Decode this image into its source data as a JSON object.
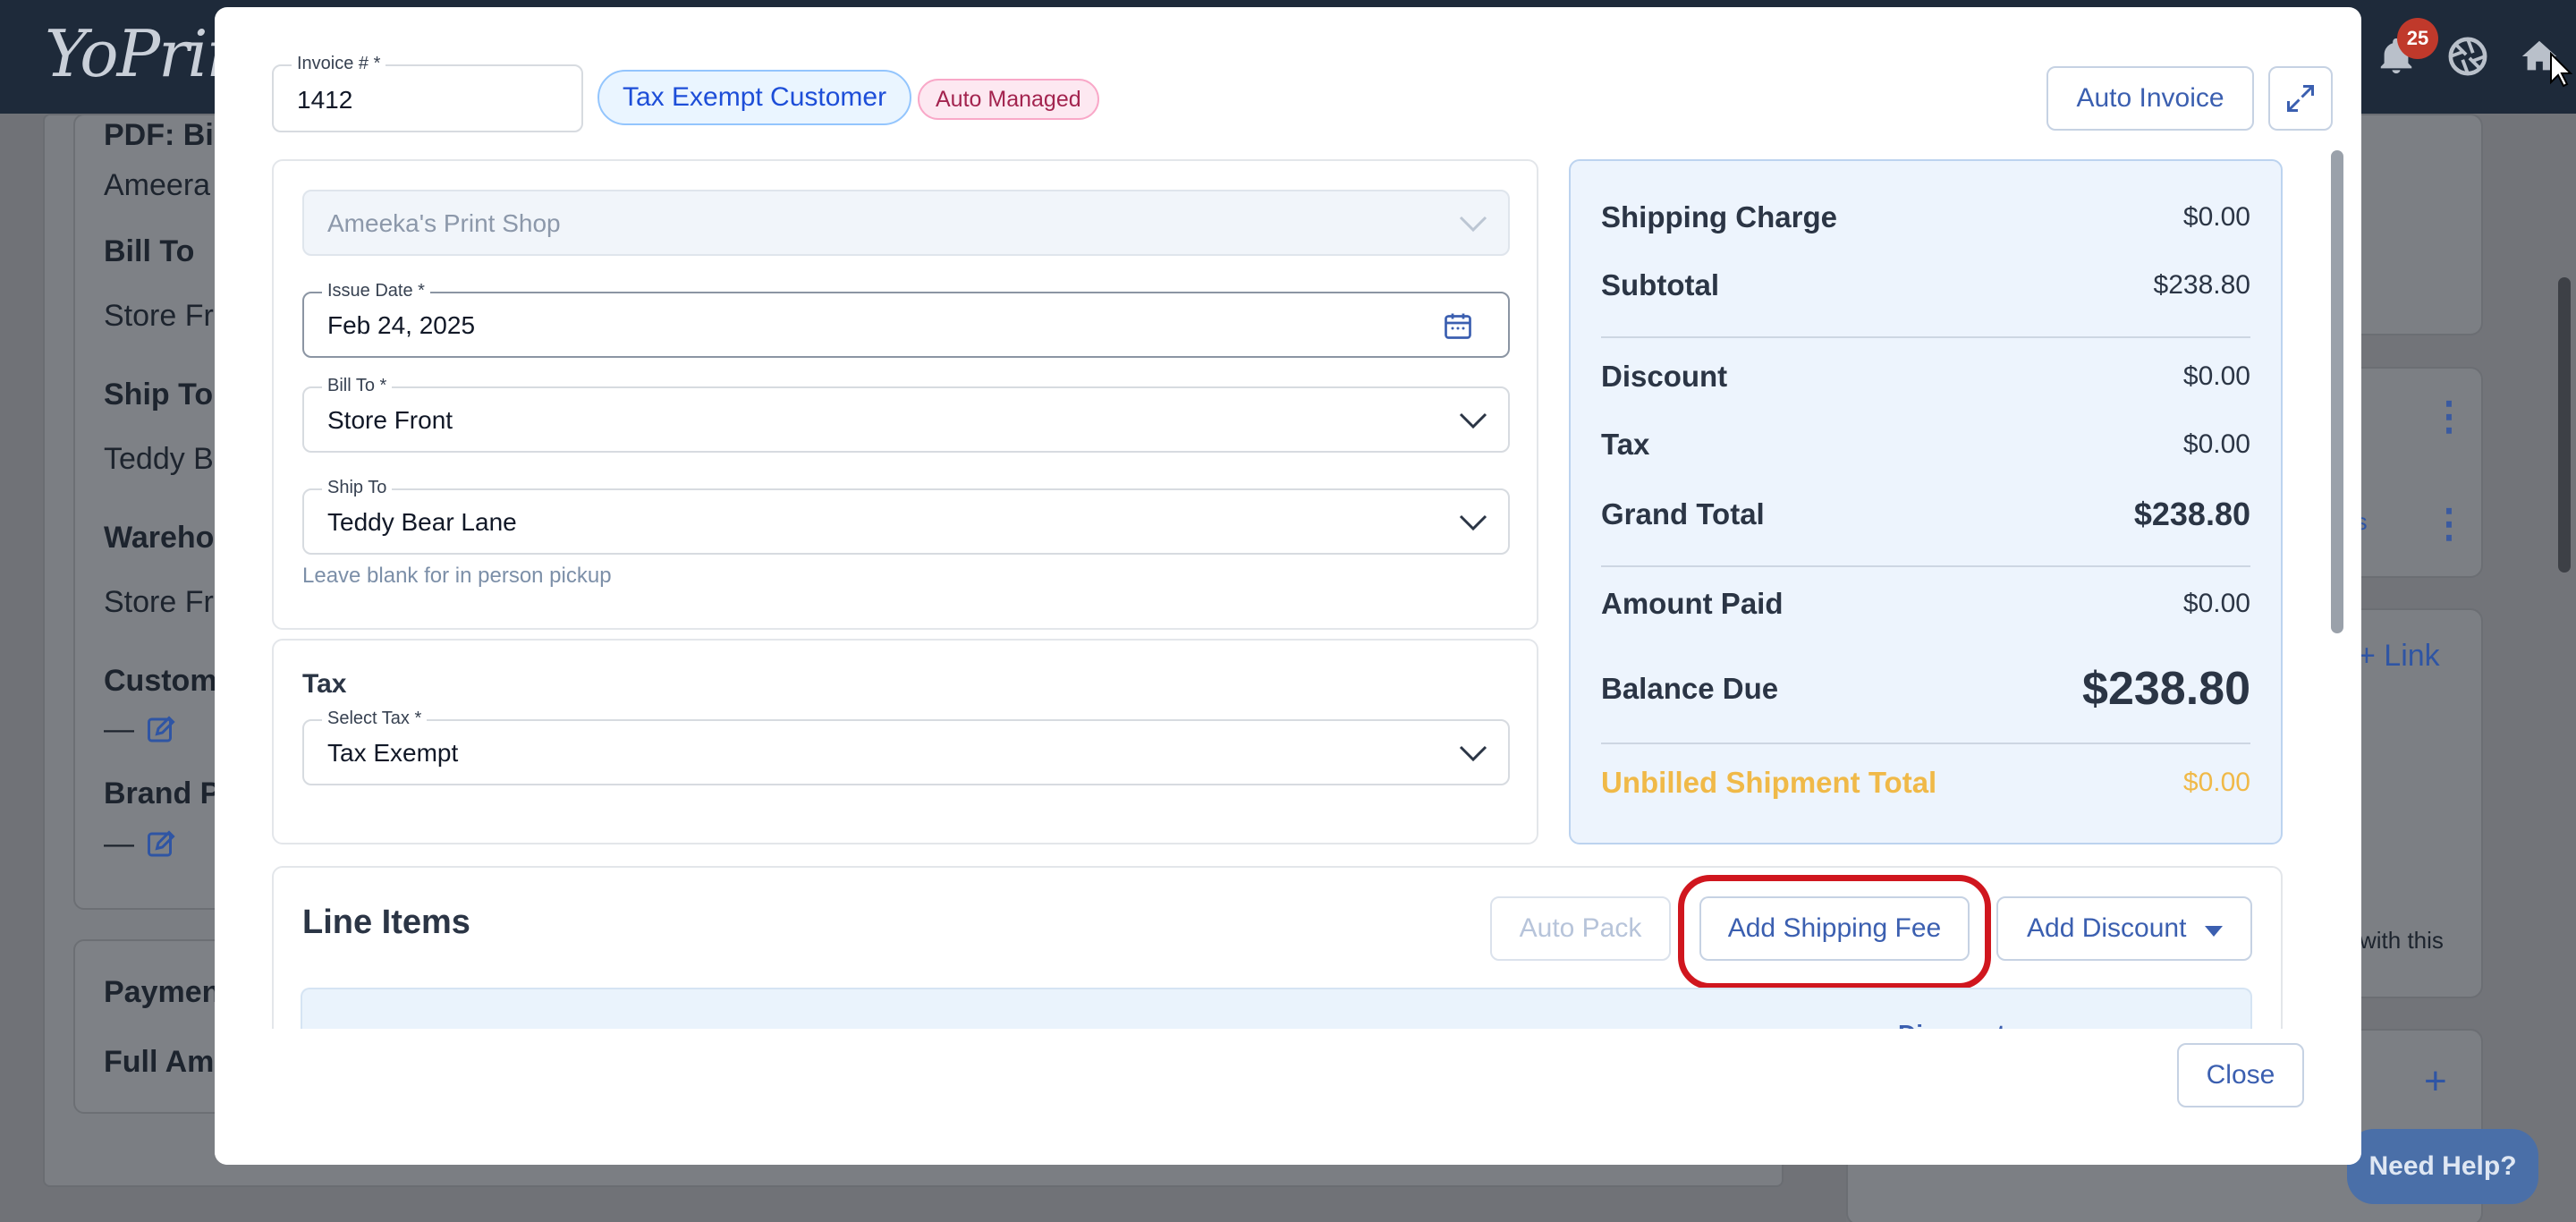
{
  "app": {
    "logo_text": "YoPrint",
    "notification_count": "25"
  },
  "background": {
    "pdf_label": "PDF: Bill",
    "customer_name_partial": "Ameera",
    "bill_to_label": "Bill To",
    "bill_to_value": "Store Fro",
    "ship_to_label": "Ship To",
    "ship_to_value": "Teddy B",
    "warehouse_label": "Warehou",
    "warehouse_value": "Store Fro",
    "customer_label": "Custome",
    "customer_value": "—",
    "brand_label": "Brand Pr",
    "brand_value": "—",
    "payment_label": "Paymen",
    "full_amount_label": "Full Amo",
    "link_label": "+ Link",
    "items_pill_partial": "ms",
    "with_this_text": "with this",
    "need_help": "Need Help?"
  },
  "invoice": {
    "invoice_number_label": "Invoice # *",
    "invoice_number": "1412",
    "tax_exempt_pill": "Tax Exempt Customer",
    "auto_managed_pill": "Auto Managed",
    "auto_invoice_button": "Auto Invoice",
    "shop_value": "Ameeka's Print Shop",
    "issue_date_label": "Issue Date *",
    "issue_date": "Feb 24, 2025",
    "bill_to_label": "Bill To *",
    "bill_to_value": "Store Front",
    "ship_to_label": "Ship To",
    "ship_to_value": "Teddy Bear Lane",
    "ship_to_hint": "Leave blank for in person pickup",
    "tax_section_title": "Tax",
    "select_tax_label": "Select Tax *",
    "select_tax_value": "Tax Exempt"
  },
  "summary": {
    "shipping_charge_label": "Shipping Charge",
    "shipping_charge": "$0.00",
    "subtotal_label": "Subtotal",
    "subtotal": "$238.80",
    "discount_label": "Discount",
    "discount": "$0.00",
    "tax_label": "Tax",
    "tax": "$0.00",
    "grand_total_label": "Grand Total",
    "grand_total": "$238.80",
    "amount_paid_label": "Amount Paid",
    "amount_paid": "$0.00",
    "balance_due_label": "Balance Due",
    "balance_due": "$238.80",
    "unbilled_label": "Unbilled Shipment Total",
    "unbilled": "$0.00",
    "unbilled_color": "#f0b948"
  },
  "line_items": {
    "title": "Line Items",
    "auto_pack_button": "Auto Pack",
    "add_shipping_fee_button": "Add Shipping Fee",
    "add_discount_button": "Add Discount",
    "table_header_partial": "Discount"
  },
  "footer": {
    "close_button": "Close"
  },
  "colors": {
    "accent": "#3b5fb0",
    "highlight_ring": "#d0161e",
    "topbar": "#1e2a3a"
  }
}
